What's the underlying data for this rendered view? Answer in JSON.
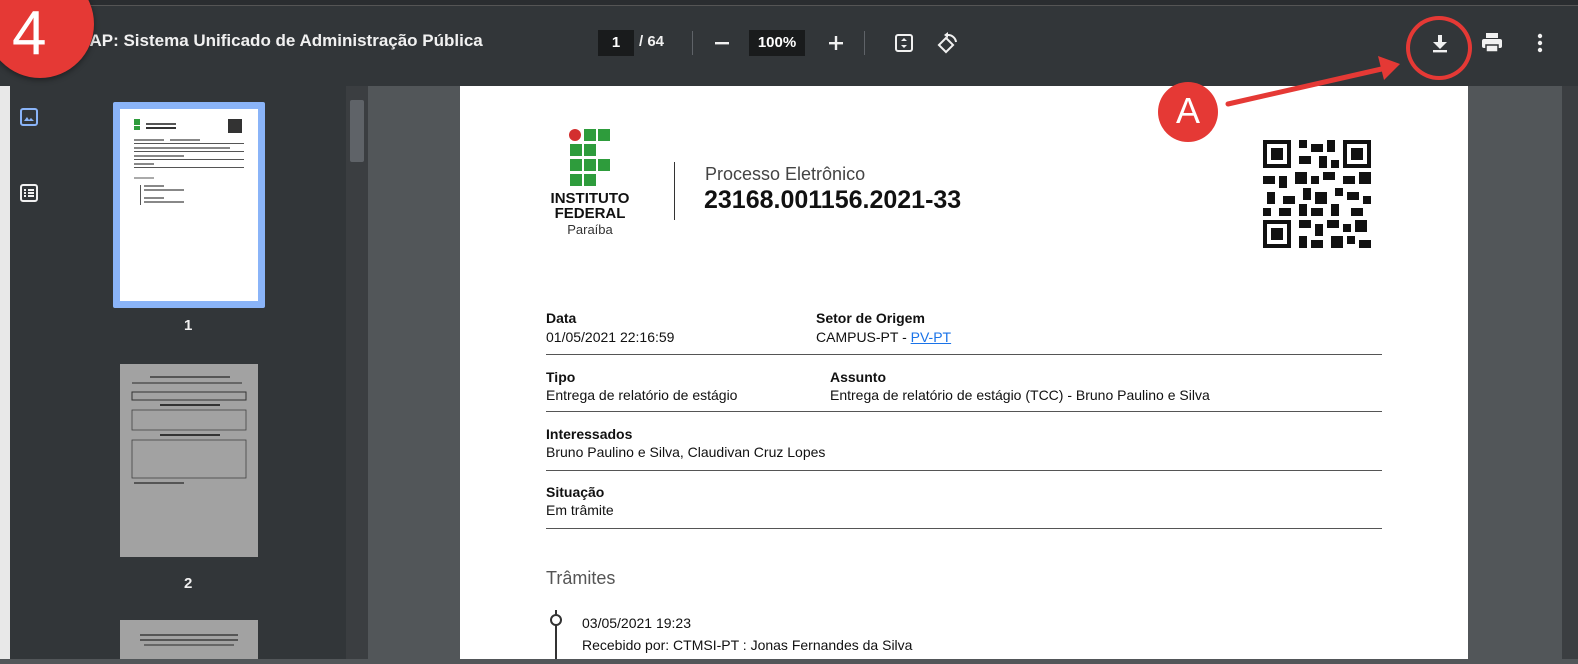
{
  "viewer": {
    "title": "JAP: Sistema Unificado de Administração Pública",
    "current_page": "1",
    "total_pages": "/ 64",
    "zoom": "100%"
  },
  "toolbar_icons": [
    "zoom-out-icon",
    "zoom-in-icon",
    "fit-page-icon",
    "rotate-icon",
    "download-icon",
    "print-icon",
    "more-icon"
  ],
  "annotations": {
    "step_number": "4",
    "marker_label": "A",
    "color": "#e53935"
  },
  "sidebar": {
    "thumbnails": [
      {
        "label": "1"
      },
      {
        "label": "2"
      }
    ]
  },
  "document": {
    "logo": {
      "line1": "INSTITUTO",
      "line2": "FEDERAL",
      "line3": "Paraíba"
    },
    "header_label": "Processo Eletrônico",
    "process_number": "23168.001156.2021-33",
    "fields": {
      "data_label": "Data",
      "data_value": "01/05/2021 22:16:59",
      "setor_label": "Setor de Origem",
      "setor_prefix": "CAMPUS-PT - ",
      "setor_link": "PV-PT",
      "tipo_label": "Tipo",
      "tipo_value": "Entrega de relatório de estágio",
      "assunto_label": "Assunto",
      "assunto_value": "Entrega de relatório de estágio (TCC) - Bruno Paulino e Silva",
      "interessados_label": "Interessados",
      "interessados_value": "Bruno Paulino e Silva, Claudivan Cruz Lopes",
      "situacao_label": "Situação",
      "situacao_value": "Em trâmite"
    },
    "tramites_title": "Trâmites",
    "tramites": [
      {
        "date": "03/05/2021 19:23",
        "detail": "Recebido por: CTMSI-PT : Jonas Fernandes da Silva"
      }
    ]
  },
  "colors": {
    "toolbar": "#323639",
    "viewer_bg": "#525659",
    "link": "#1a73e8",
    "logo_green": "#2e9c3c",
    "logo_red": "#d32f2f"
  }
}
